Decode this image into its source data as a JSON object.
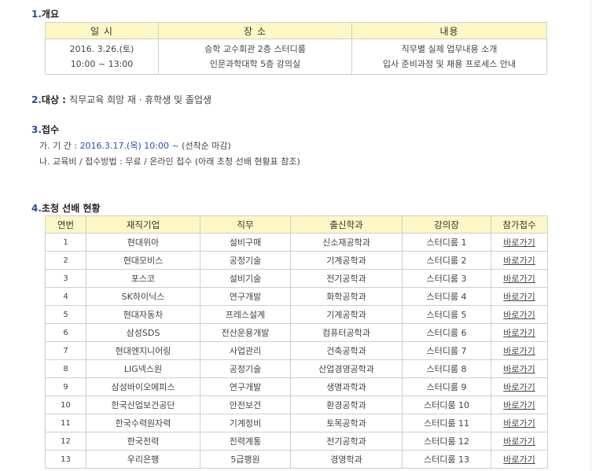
{
  "section1": {
    "num": "1.",
    "title": "개요"
  },
  "overview": {
    "headers": [
      "일 시",
      "장 소",
      "내용"
    ],
    "date_line1": "2016. 3.26.(토)",
    "date_line2": "10:00 ~ 13:00",
    "place_line1": "승학 교수회관 2층 스터디룸",
    "place_line2": "인문과학대학 5층 강의실",
    "content_line1": "직무별 실제 업무내용 소개",
    "content_line2": "입사 준비과정 및 채용 프로세스 안내"
  },
  "section2": {
    "num": "2.",
    "title": "대상 : ",
    "text": "직무교육 희망 재ㆍ휴학생 및 졸업생"
  },
  "section3": {
    "num": "3.",
    "title": "접수",
    "line_a_prefix": "가. 기 간 : ",
    "line_a_blue": "2016.3.17.(목) 10:00 ~",
    "line_a_suffix": " (선착순 마감)",
    "line_b": "나. 교육비 / 접수방법 : 무료 / 온라인 접수 (아래 초청 선배 현황표 참조)"
  },
  "section4": {
    "num": "4.",
    "title": "초청 선배 현황"
  },
  "mentors": {
    "headers": [
      "연번",
      "재직기업",
      "직무",
      "출신학과",
      "강의장",
      "참가접수"
    ],
    "rows": [
      {
        "no": "1",
        "company": "현대위아",
        "job": "설비구매",
        "dept": "신소재공학과",
        "room": "스터디룸 1",
        "apply": "바로가기"
      },
      {
        "no": "2",
        "company": "현대모비스",
        "job": "공정기술",
        "dept": "기계공학과",
        "room": "스터디룸 2",
        "apply": "바로가기"
      },
      {
        "no": "3",
        "company": "포스코",
        "job": "설비기술",
        "dept": "전기공학과",
        "room": "스터디룸 3",
        "apply": "바로가기"
      },
      {
        "no": "4",
        "company": "SK하이닉스",
        "job": "연구개발",
        "dept": "화학공학과",
        "room": "스터디룸 4",
        "apply": "바로가기"
      },
      {
        "no": "5",
        "company": "현대자동차",
        "job": "프레스설계",
        "dept": "기계공학과",
        "room": "스터디룸 5",
        "apply": "바로가기"
      },
      {
        "no": "6",
        "company": "삼성SDS",
        "job": "전산운용개발",
        "dept": "컴퓨터공학과",
        "room": "스터디룸 6",
        "apply": "바로가기"
      },
      {
        "no": "7",
        "company": "현대엔지니어링",
        "job": "사업관리",
        "dept": "건축공학과",
        "room": "스터디룸 7",
        "apply": "바로가기"
      },
      {
        "no": "8",
        "company": "LIG넥스원",
        "job": "공정기술",
        "dept": "산업경영공학과",
        "room": "스터디룸 8",
        "apply": "바로가기"
      },
      {
        "no": "9",
        "company": "삼성바이오에피스",
        "job": "연구개발",
        "dept": "생명과학과",
        "room": "스터디룸 9",
        "apply": "바로가기"
      },
      {
        "no": "10",
        "company": "한국산업보건공단",
        "job": "안전보건",
        "dept": "환경공학과",
        "room": "스터디룸 10",
        "apply": "바로가기"
      },
      {
        "no": "11",
        "company": "한국수력원자력",
        "job": "기계정비",
        "dept": "토목공학과",
        "room": "스터디룸 11",
        "apply": "바로가기"
      },
      {
        "no": "12",
        "company": "한국전력",
        "job": "전력계통",
        "dept": "전기공학과",
        "room": "스터디룸 12",
        "apply": "바로가기"
      },
      {
        "no": "13",
        "company": "우리은행",
        "job": "5급행원",
        "dept": "경영학과",
        "room": "스터디룸 13",
        "apply": "바로가기"
      }
    ]
  }
}
